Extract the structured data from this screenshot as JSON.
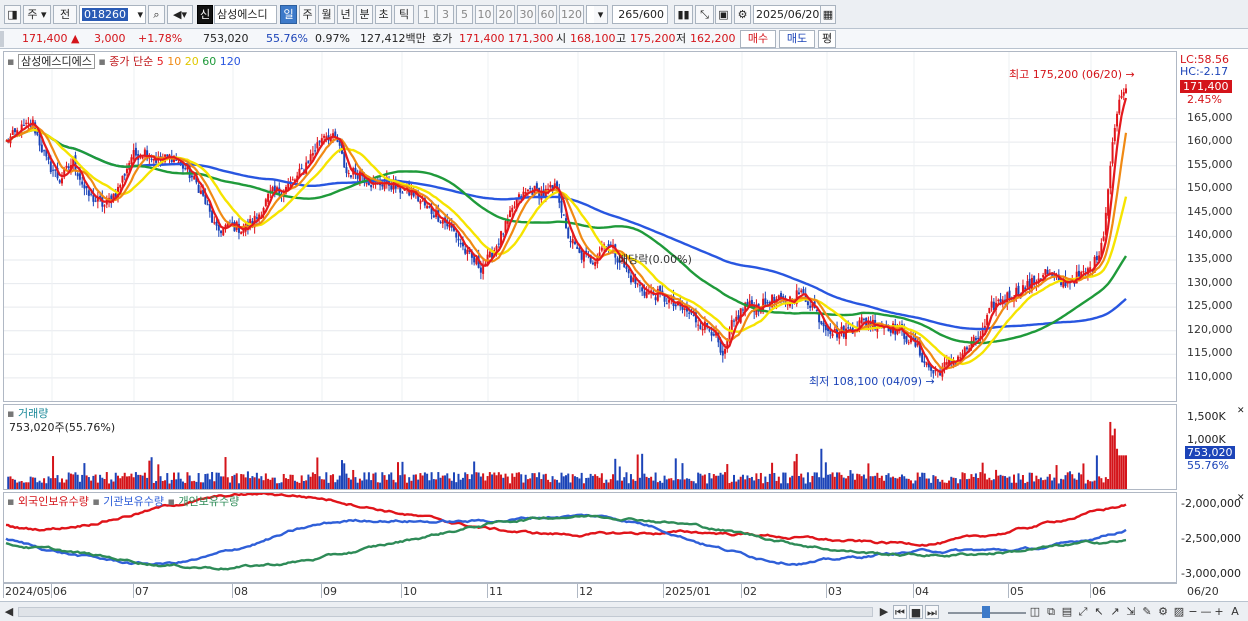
{
  "toolbar": {
    "type_select": "주",
    "prev_label": "전",
    "code": "018260",
    "shin": "신",
    "stock_name": "삼성에스디",
    "periods": [
      "일",
      "주",
      "월",
      "년",
      "분",
      "초",
      "틱"
    ],
    "selected_period": "일",
    "intervals": [
      "1",
      "3",
      "5",
      "10",
      "20",
      "30",
      "60",
      "120"
    ],
    "count": "265",
    "count_max": "/600",
    "date": "2025/06/20"
  },
  "quote": {
    "price": "171,400",
    "change": "3,000",
    "change_pct": "+1.78%",
    "volume": "753,020",
    "volume_ratio": "55.76%",
    "turnover_ratio": "0.97%",
    "amount": "127,412백만",
    "ask_label": "호가",
    "ask": "171,400",
    "bid": "171,300",
    "open_label": "시",
    "open": "168,100",
    "high_label": "고",
    "high": "175,200",
    "low_label": "저",
    "low": "162,200",
    "buy_button": "매수",
    "sell_button": "매도",
    "eval_button": "평"
  },
  "price_pane": {
    "name_label": "삼성에스디에스",
    "ma_label": "종가 단순",
    "ma_periods": [
      "5",
      "10",
      "20",
      "60",
      "120"
    ],
    "ma_colors": [
      "#e4191d",
      "#f08a14",
      "#f6e400",
      "#1f9a3a",
      "#2856e0"
    ],
    "lc_label": "LC:58.56",
    "hc_label": "HC:-2.17",
    "current_price": "171,400",
    "current_pct": "2.45%",
    "high_annotation": "최고 175,200 (06/20)",
    "low_annotation": "최저 108,100 (04/09)",
    "dividend_annotation": "배당락(0.00%)",
    "y_ticks": [
      "165,000",
      "160,000",
      "155,000",
      "150,000",
      "145,000",
      "140,000",
      "135,000",
      "130,000",
      "125,000",
      "120,000",
      "115,000",
      "110,000"
    ]
  },
  "volume_pane": {
    "title": "거래량",
    "value_label": "753,020주(55.76%)",
    "y_ticks": [
      "1,500K",
      "1,000K"
    ],
    "current": "753,020",
    "current_pct": "55.76%"
  },
  "holding_pane": {
    "series_labels": [
      "외국인보유수량",
      "기관보유수량",
      "개인보유수량"
    ],
    "series_colors": [
      "#e0141a",
      "#2f5fd8",
      "#2e8b57"
    ],
    "y_ticks": [
      "-2,000,000",
      "-2,500,000",
      "-3,000,000"
    ]
  },
  "x_axis": {
    "labels": [
      "2024/05",
      "06",
      "07",
      "08",
      "09",
      "10",
      "11",
      "12",
      "2025/01",
      "02",
      "03",
      "04",
      "05",
      "06"
    ],
    "end_label": "06/20"
  },
  "chart_data": {
    "type": "candlestick",
    "title": "",
    "x_range": [
      "2024/05",
      "2025/06/20"
    ],
    "ylim": [
      107000,
      177000
    ],
    "close_series": [
      [
        0,
        160000
      ],
      [
        6,
        162500
      ],
      [
        12,
        164000
      ],
      [
        18,
        156000
      ],
      [
        24,
        152000
      ],
      [
        30,
        156000
      ],
      [
        36,
        149000
      ],
      [
        44,
        146500
      ],
      [
        50,
        150000
      ],
      [
        56,
        157000
      ],
      [
        62,
        158000
      ],
      [
        68,
        156000
      ],
      [
        74,
        157000
      ],
      [
        80,
        154500
      ],
      [
        86,
        150500
      ],
      [
        90,
        146000
      ],
      [
        94,
        141000
      ],
      [
        100,
        142500
      ],
      [
        106,
        141500
      ],
      [
        112,
        144000
      ],
      [
        118,
        149000
      ],
      [
        124,
        150000
      ],
      [
        130,
        152500
      ],
      [
        136,
        157000
      ],
      [
        142,
        162000
      ],
      [
        148,
        160000
      ],
      [
        152,
        153500
      ],
      [
        158,
        153500
      ],
      [
        164,
        151000
      ],
      [
        170,
        151500
      ],
      [
        176,
        150000
      ],
      [
        182,
        149000
      ],
      [
        188,
        146000
      ],
      [
        194,
        144000
      ],
      [
        200,
        141000
      ],
      [
        206,
        136000
      ],
      [
        212,
        133500
      ],
      [
        216,
        135500
      ],
      [
        222,
        141000
      ],
      [
        228,
        147500
      ],
      [
        234,
        150000
      ],
      [
        240,
        149000
      ],
      [
        246,
        150500
      ],
      [
        250,
        141000
      ],
      [
        256,
        136000
      ],
      [
        262,
        135000
      ],
      [
        268,
        139000
      ],
      [
        274,
        135000
      ],
      [
        280,
        130500
      ],
      [
        286,
        128000
      ],
      [
        292,
        127500
      ],
      [
        298,
        125500
      ],
      [
        304,
        124000
      ],
      [
        310,
        121500
      ],
      [
        316,
        120000
      ],
      [
        320,
        113500
      ],
      [
        324,
        121000
      ],
      [
        330,
        125500
      ],
      [
        336,
        125000
      ],
      [
        342,
        126500
      ],
      [
        348,
        126000
      ],
      [
        354,
        128000
      ],
      [
        360,
        125500
      ],
      [
        364,
        122000
      ],
      [
        370,
        119500
      ],
      [
        376,
        120000
      ],
      [
        382,
        122000
      ],
      [
        388,
        121500
      ],
      [
        394,
        121000
      ],
      [
        400,
        119500
      ],
      [
        406,
        117000
      ],
      [
        410,
        113500
      ],
      [
        414,
        111000
      ],
      [
        418,
        112000
      ],
      [
        424,
        114000
      ],
      [
        430,
        116500
      ],
      [
        436,
        119500
      ],
      [
        440,
        125000
      ],
      [
        446,
        127000
      ],
      [
        452,
        128500
      ],
      [
        458,
        130000
      ],
      [
        464,
        132500
      ],
      [
        470,
        130000
      ],
      [
        476,
        131000
      ],
      [
        482,
        132000
      ],
      [
        486,
        134500
      ],
      [
        490,
        140000
      ],
      [
        494,
        160000
      ],
      [
        497,
        169000
      ],
      [
        500,
        171400
      ]
    ],
    "ma_series_names": [
      "5",
      "10",
      "20",
      "60",
      "120"
    ],
    "volume_max_k": 1700,
    "volume_current": 753020,
    "holding_ylim": [
      -3100000,
      -1900000
    ]
  }
}
